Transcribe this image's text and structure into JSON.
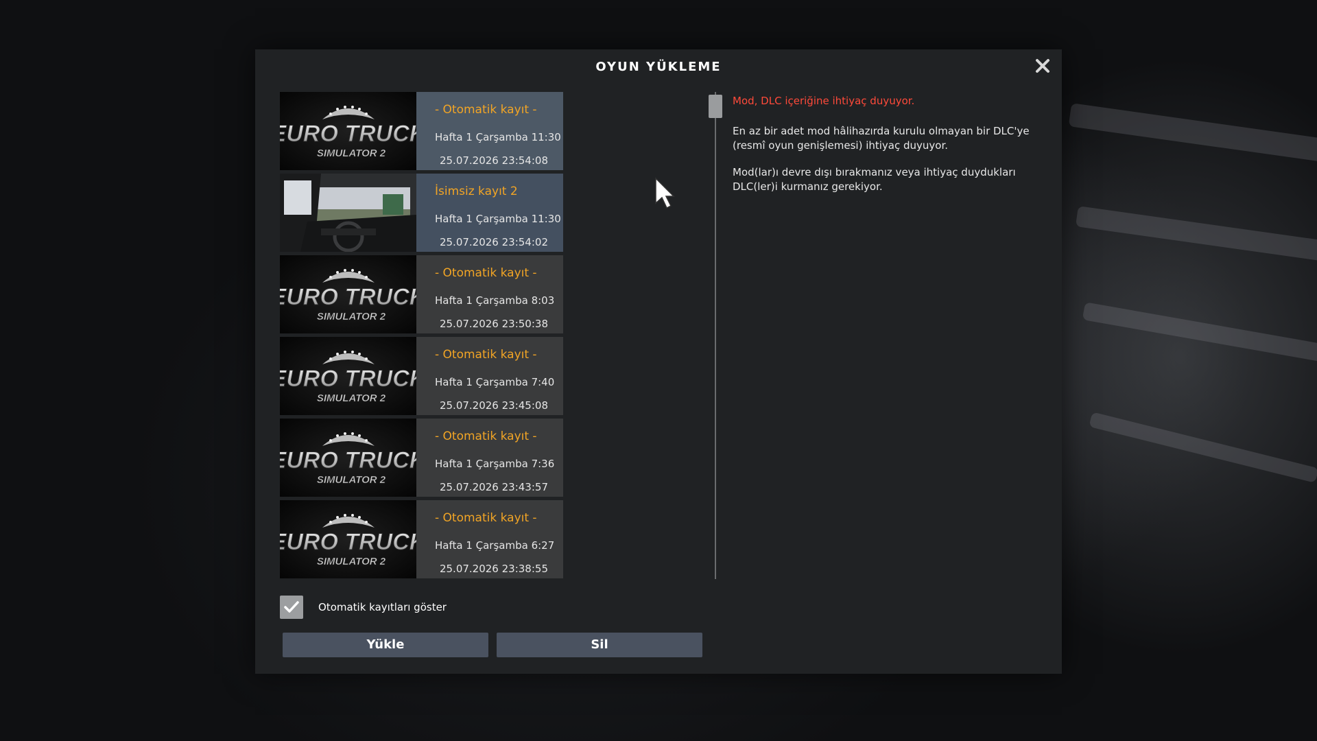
{
  "dialog": {
    "title": "OYUN YÜKLEME"
  },
  "saves": [
    {
      "name": "- Otomatik kayıt -",
      "time": "Hafta 1  Çarşamba 11:30",
      "date": "25.07.2026  23:54:08",
      "thumbnail": "ets2-logo",
      "state": "selected"
    },
    {
      "name": "İsimsiz kayıt 2",
      "time": "Hafta 1  Çarşamba 11:30",
      "date": "25.07.2026  23:54:02",
      "thumbnail": "cabin-screenshot",
      "state": "hovered"
    },
    {
      "name": "- Otomatik kayıt -",
      "time": "Hafta 1  Çarşamba 8:03",
      "date": "25.07.2026  23:50:38",
      "thumbnail": "ets2-logo",
      "state": "normal"
    },
    {
      "name": "- Otomatik kayıt -",
      "time": "Hafta 1  Çarşamba 7:40",
      "date": "25.07.2026  23:45:08",
      "thumbnail": "ets2-logo",
      "state": "normal"
    },
    {
      "name": "- Otomatik kayıt -",
      "time": "Hafta 1  Çarşamba 7:36",
      "date": "25.07.2026  23:43:57",
      "thumbnail": "ets2-logo",
      "state": "normal"
    },
    {
      "name": "- Otomatik kayıt -",
      "time": "Hafta 1  Çarşamba 6:27",
      "date": "25.07.2026  23:38:55",
      "thumbnail": "ets2-logo",
      "state": "normal"
    }
  ],
  "logo": {
    "line1": "EURO TRUCK",
    "line2": "SIMULATOR 2"
  },
  "details": {
    "warning": "Mod, DLC içeriğine ihtiyaç duyuyor.",
    "paragraph1": "En az bir adet mod hâlihazırda kurulu olmayan bir DLC'ye (resmî oyun genişlemesi) ihtiyaç duyuyor.",
    "paragraph2": "Mod(lar)ı devre dışı bırakmanız veya ihtiyaç duydukları DLC(ler)i kurmanız gerekiyor."
  },
  "options": {
    "show_autosaves_label": "Otomatik kayıtları göster",
    "show_autosaves_checked": true
  },
  "buttons": {
    "load": "Yükle",
    "delete": "Sil"
  },
  "colors": {
    "dialog_bg": "#202224",
    "row_bg": "#3a3b3c",
    "row_selected_bg": "#4d5966",
    "save_name": "#f2a525",
    "warning": "#ff4a3a",
    "button_bg": "#4a5260"
  }
}
